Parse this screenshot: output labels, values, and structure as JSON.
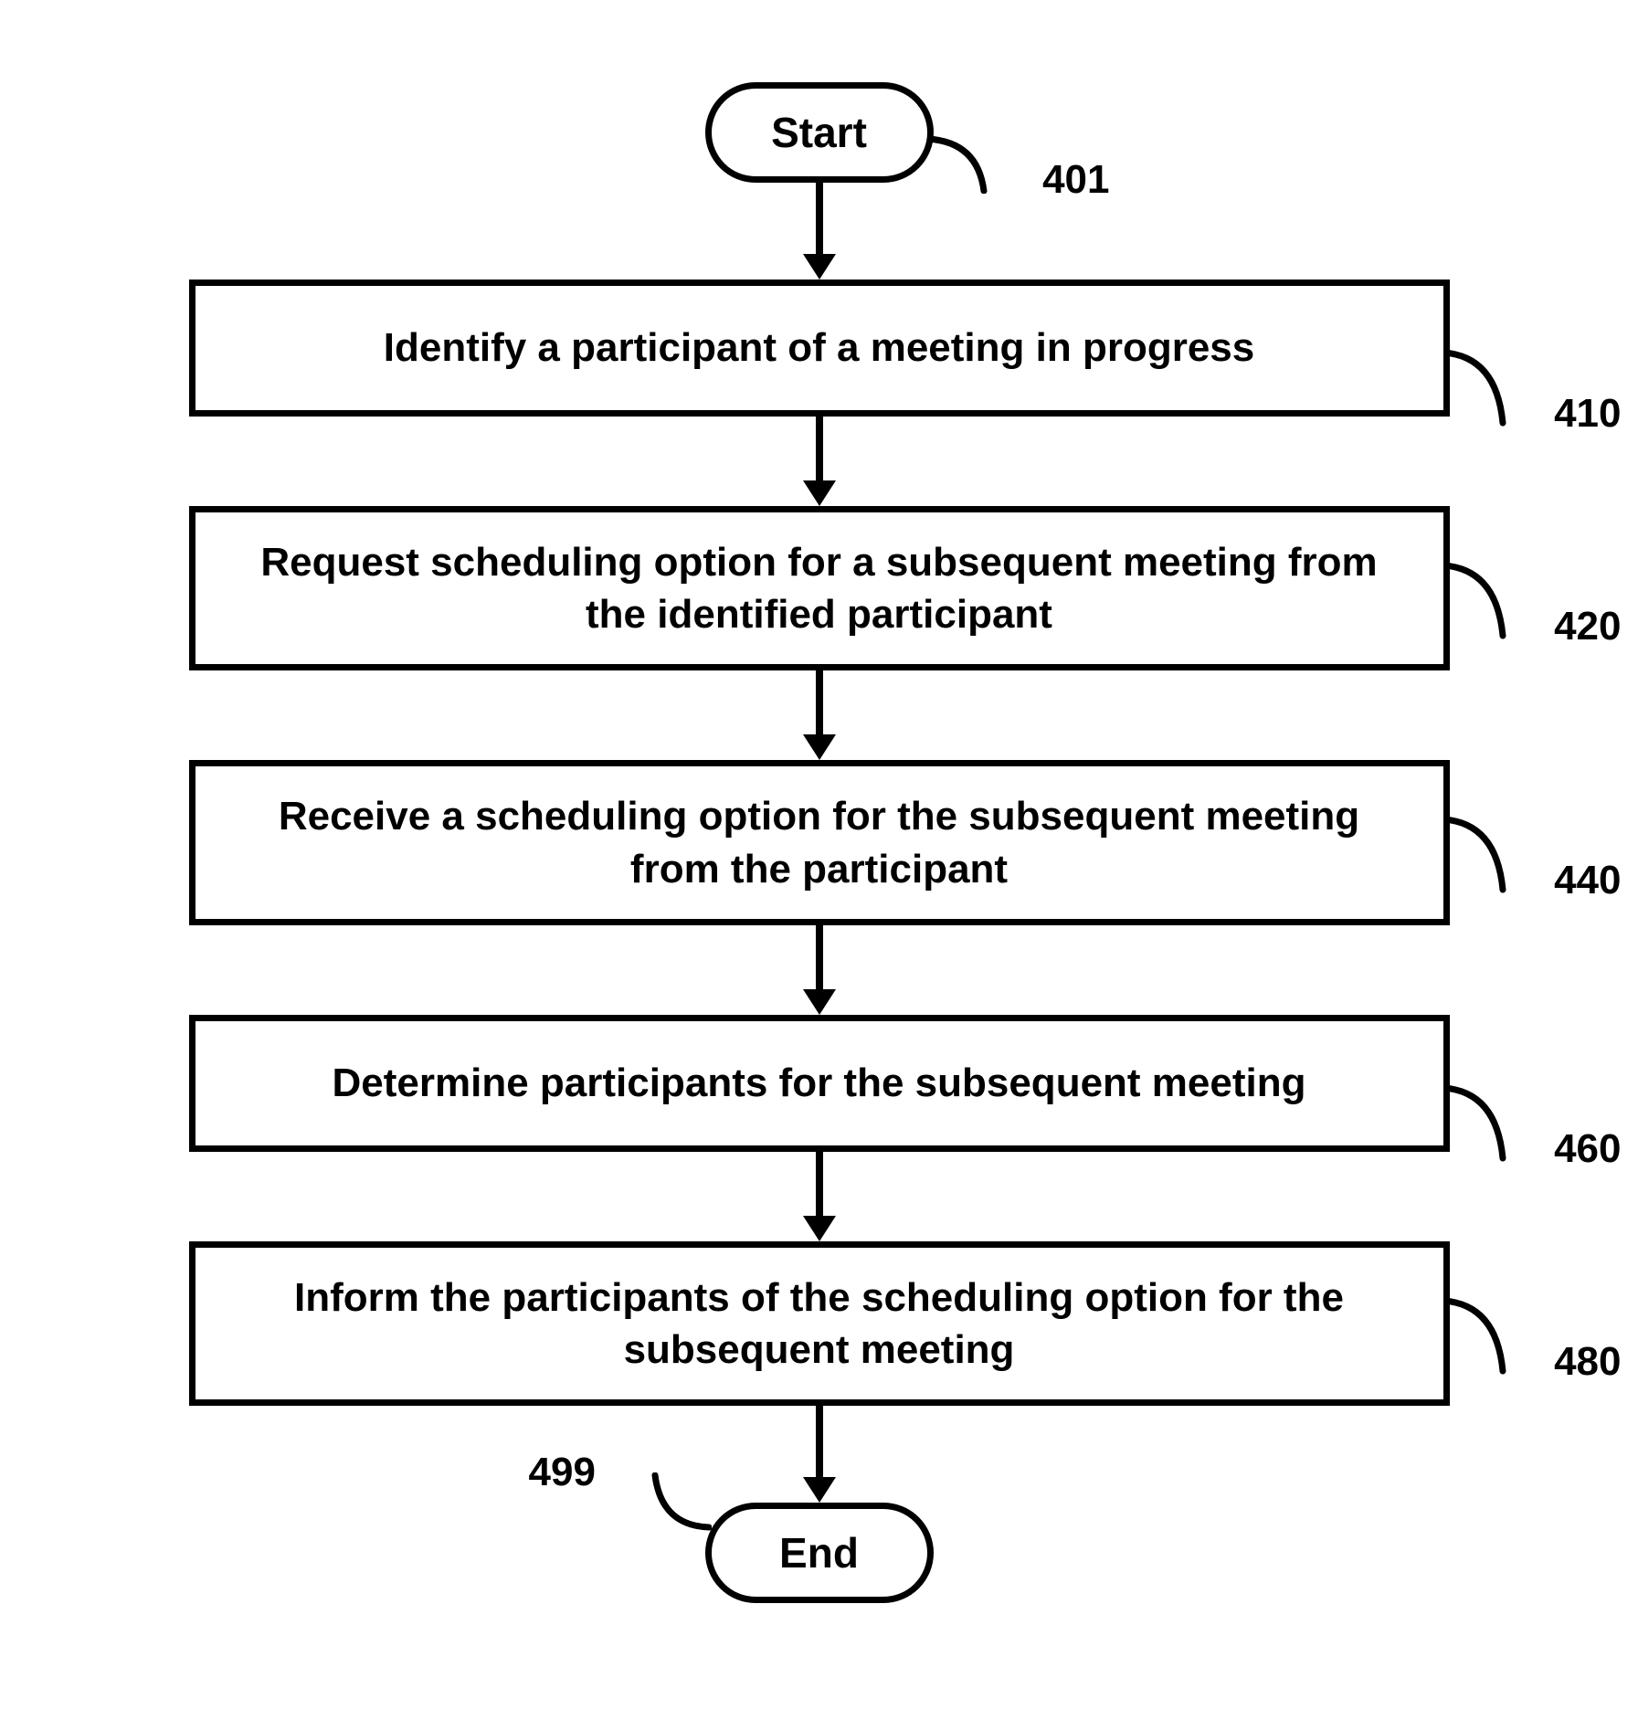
{
  "flowchart": {
    "start": {
      "label": "Start",
      "ref": "401"
    },
    "end": {
      "label": "End",
      "ref": "499"
    },
    "steps": [
      {
        "text": "Identify a participant of a  meeting in progress",
        "ref": "410"
      },
      {
        "text": "Request scheduling option for a subsequent meeting from the identified participant",
        "ref": "420"
      },
      {
        "text": "Receive a scheduling option for the subsequent meeting from the participant",
        "ref": "440"
      },
      {
        "text": "Determine participants for the subsequent meeting",
        "ref": "460"
      },
      {
        "text": "Inform the participants of the scheduling option for the subsequent meeting",
        "ref": "480"
      }
    ]
  }
}
